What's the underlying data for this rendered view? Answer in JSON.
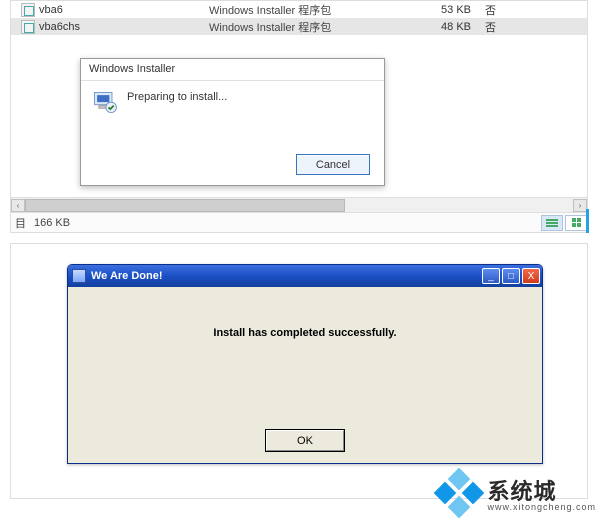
{
  "explorer": {
    "rows": [
      {
        "icon": "msi",
        "name": "vba6",
        "type": "Windows Installer 程序包",
        "size": "53 KB",
        "attr": "否"
      },
      {
        "icon": "msi",
        "name": "vba6chs",
        "type": "Windows Installer 程序包",
        "size": "48 KB",
        "attr": "否"
      }
    ],
    "scroll": {
      "left_arrow": "‹",
      "right_arrow": "›"
    },
    "statusbar": {
      "selected_label": "目",
      "size": "166 KB"
    }
  },
  "installer_dialog": {
    "title": "Windows Installer",
    "message": "Preparing to install...",
    "cancel_label": "Cancel"
  },
  "done_dialog": {
    "title": "We Are Done!",
    "message": "Install has completed successfully.",
    "ok_label": "OK",
    "min_glyph": "_",
    "max_glyph": "□",
    "close_glyph": "X"
  },
  "watermark": {
    "brand": "系统城",
    "url": "www.xitongcheng.com"
  }
}
